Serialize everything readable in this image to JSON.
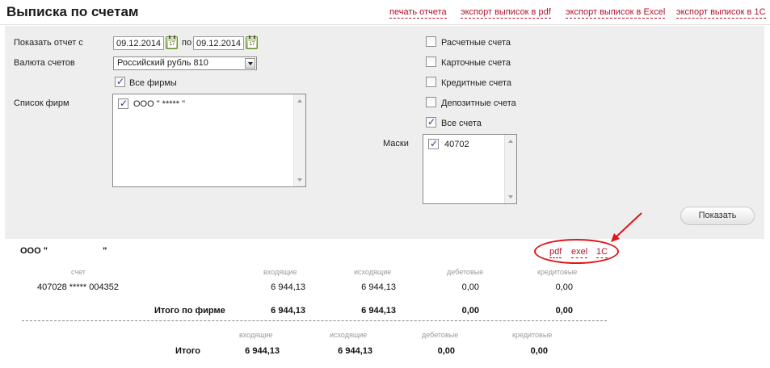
{
  "page": {
    "title": "Выписка по счетам"
  },
  "top_links": {
    "print": "печать отчета",
    "export_pdf": "экспорт выписок в pdf",
    "export_excel": "экспорт выписок в Excel",
    "export_1c": "экспорт выписок в 1С"
  },
  "filter": {
    "period_label": "Показать отчет с",
    "date_from": "09.12.2014",
    "to_label": "по",
    "date_to": "09.12.2014",
    "currency_label": "Валюта счетов",
    "currency_value": "Российский рубль 810",
    "all_firms_label": "Все фирмы",
    "all_firms_checked": true,
    "firms_list_label": "Список фирм",
    "firms": [
      {
        "name": "ООО \" ***** \"",
        "checked": true
      }
    ],
    "account_types": [
      {
        "label": "Расчетные счета",
        "checked": false
      },
      {
        "label": "Карточные счета",
        "checked": false
      },
      {
        "label": "Кредитные счета",
        "checked": false
      },
      {
        "label": "Депозитные счета",
        "checked": false
      },
      {
        "label": "Все счета",
        "checked": true
      }
    ],
    "masks_label": "Маски",
    "masks": [
      {
        "value": "40702",
        "checked": true
      }
    ],
    "show_button": "Показать"
  },
  "report": {
    "firm_name": "ООО \"",
    "firm_name_close": "\"",
    "export_links": {
      "pdf": "pdf",
      "excel": "exel",
      "c1": "1С"
    },
    "columns": {
      "account": "счет",
      "incoming": "входящие",
      "outgoing": "исходящие",
      "debit": "дебетовые",
      "credit": "кредитовые"
    },
    "rows": [
      {
        "account": "407028 ***** 004352",
        "incoming": "6 944,13",
        "outgoing": "6 944,13",
        "debit": "0,00",
        "credit": "0,00"
      }
    ],
    "firm_total": {
      "label": "Итого по фирме",
      "incoming": "6 944,13",
      "outgoing": "6 944,13",
      "debit": "0,00",
      "credit": "0,00"
    },
    "total_columns": {
      "incoming": "входящие",
      "outgoing": "исходящие",
      "debit": "дебетовые",
      "credit": "кредитовые"
    },
    "grand_total": {
      "label": "Итого",
      "incoming": "6 944,13",
      "outgoing": "6 944,13",
      "debit": "0,00",
      "credit": "0,00"
    }
  },
  "colors": {
    "link": "#b0122b",
    "panel": "#eeeeee",
    "annotation": "#e0141c",
    "checkmark": "#2b3f88"
  },
  "icons": [
    "calendar-icon",
    "dropdown-arrow-icon",
    "checkbox-checked-icon",
    "scroll-up-icon",
    "scroll-down-icon",
    "annotation-arrow-icon"
  ]
}
